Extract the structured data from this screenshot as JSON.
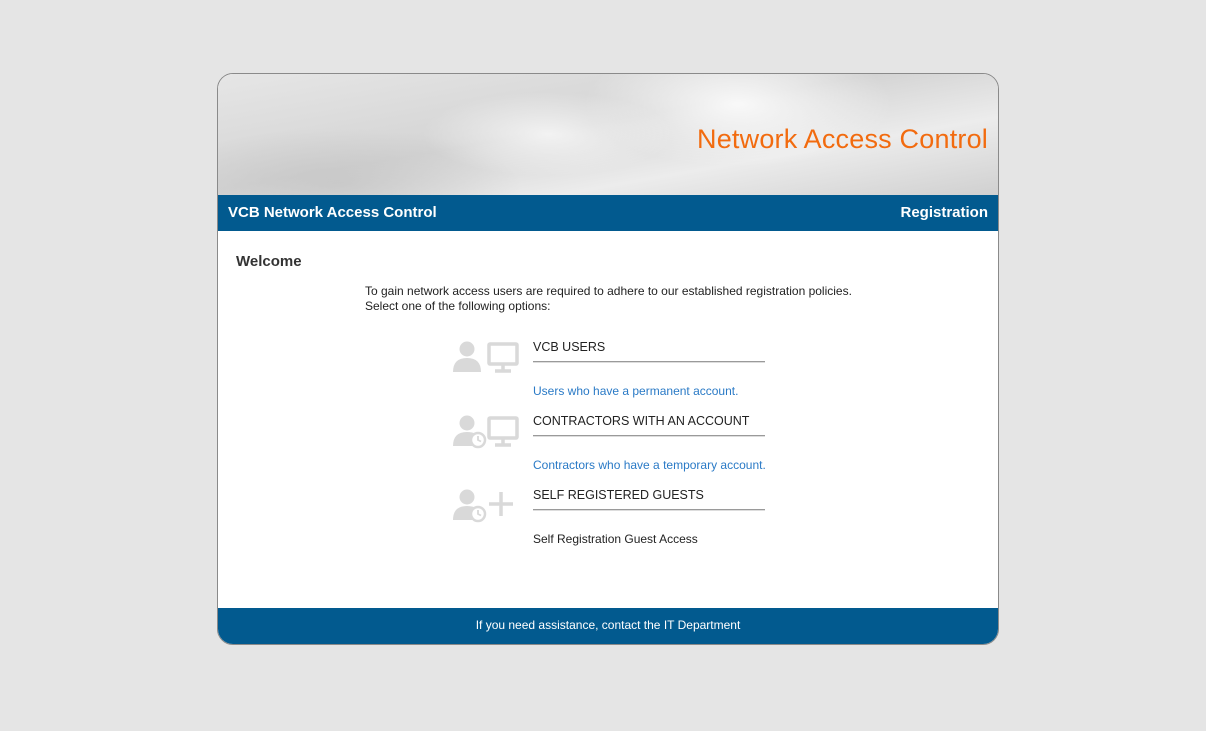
{
  "banner": {
    "title": "Network Access Control"
  },
  "navbar": {
    "left_title": "VCB Network Access Control",
    "right_title": "Registration"
  },
  "main": {
    "heading": "Welcome",
    "intro_line1": "To gain network access users are required to adhere to our established registration policies.",
    "intro_line2": "Select one of the following options:",
    "options": [
      {
        "title": "VCB USERS",
        "description": "Users who have a permanent account.",
        "icons": [
          "user-icon",
          "monitor-icon"
        ]
      },
      {
        "title": "CONTRACTORS WITH AN ACCOUNT",
        "description": "Contractors who have a temporary account.",
        "icons": [
          "user-clock-icon",
          "monitor-icon"
        ]
      },
      {
        "title": "SELF REGISTERED GUESTS",
        "description": "Self Registration Guest Access",
        "icons": [
          "user-clock-icon",
          "plus-icon"
        ]
      }
    ]
  },
  "footer": {
    "text": "If you need assistance, contact the IT Department"
  },
  "colors": {
    "brand_blue": "#025a8f",
    "accent_orange": "#f26b0f",
    "link_blue": "#2a7ac6",
    "icon_gray": "#d9d9d9"
  }
}
